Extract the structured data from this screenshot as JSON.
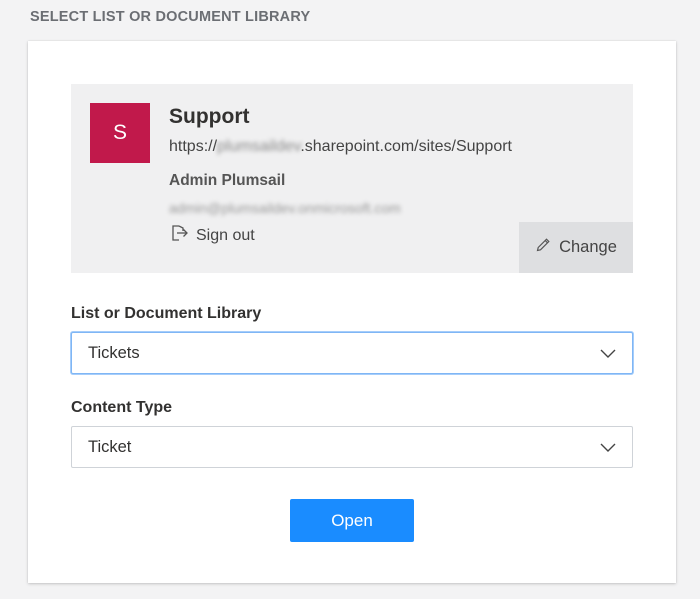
{
  "header": {
    "title": "SELECT LIST OR DOCUMENT LIBRARY"
  },
  "site": {
    "avatar_letter": "S",
    "avatar_color": "#c1194b",
    "title": "Support",
    "url_prefix": "https://",
    "url_redacted": "plumsaildev",
    "url_suffix": ".sharepoint.com/sites/Support",
    "user_name": "Admin Plumsail",
    "user_email": "admin@plumsaildev.onmicrosoft.com",
    "signout_label": "Sign out",
    "change_label": "Change"
  },
  "list_field": {
    "label": "List or Document Library",
    "value": "Tickets"
  },
  "content_type_field": {
    "label": "Content Type",
    "value": "Ticket"
  },
  "actions": {
    "open_label": "Open",
    "open_color": "#1a8cff"
  },
  "icons": {
    "signout": "sign-out-icon",
    "change": "pencil-icon",
    "dropdown": "chevron-down-icon"
  }
}
